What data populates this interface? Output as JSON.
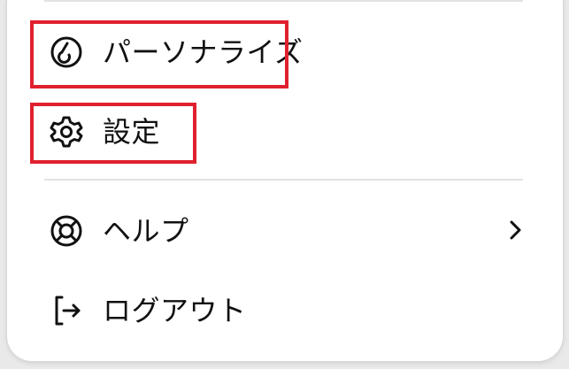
{
  "menu": {
    "items": [
      {
        "id": "personalize",
        "label": "パーソナライズ",
        "icon": "personalize-icon",
        "highlighted": true
      },
      {
        "id": "settings",
        "label": "設定",
        "icon": "gear-icon",
        "highlighted": true
      },
      {
        "id": "help",
        "label": "ヘルプ",
        "icon": "lifebuoy-icon",
        "has_submenu": true
      },
      {
        "id": "logout",
        "label": "ログアウト",
        "icon": "logout-icon"
      }
    ]
  },
  "colors": {
    "highlight": "#e0202e",
    "text": "#111111",
    "divider": "#e2e2e2",
    "panel": "#ffffff"
  }
}
